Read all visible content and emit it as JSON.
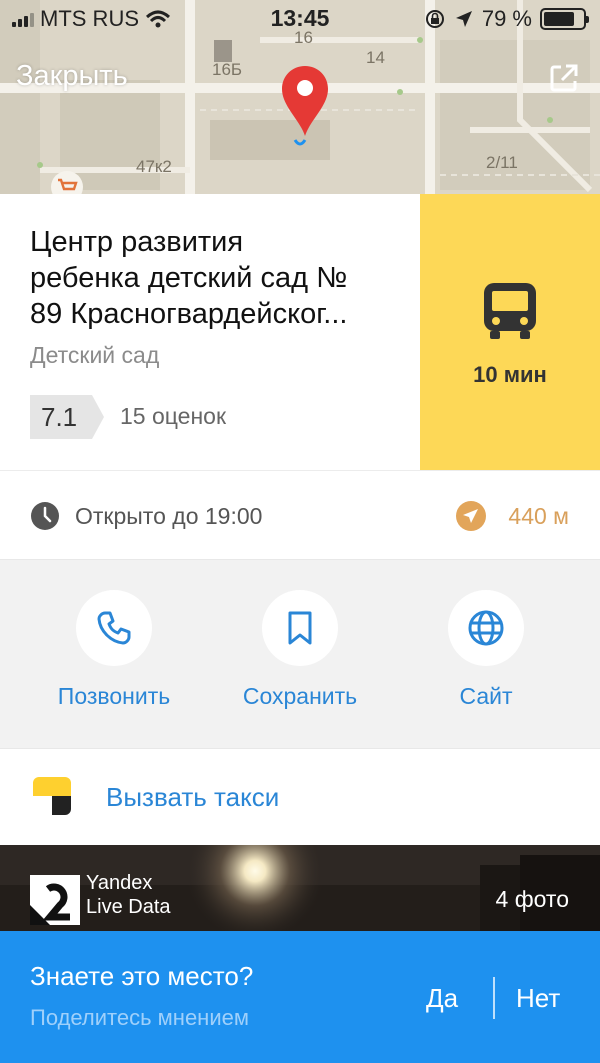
{
  "status_bar": {
    "carrier": "MTS RUS",
    "time": "13:45",
    "battery_text": "79 %",
    "battery_level": 0.79
  },
  "map": {
    "close_label": "Закрыть",
    "labels": [
      "16",
      "16Б",
      "14",
      "47к2",
      "2/11"
    ]
  },
  "place": {
    "title_lines": [
      "Центр развития",
      "ребенка детский сад №",
      "89 Красногвардейског..."
    ],
    "category": "Детский сад",
    "rating": "7.1",
    "rating_count": "15 оценок"
  },
  "route": {
    "icon": "bus-icon",
    "time": "10 мин"
  },
  "hours": {
    "text": "Открыто до 19:00",
    "distance": "440 м"
  },
  "actions": [
    {
      "label": "Позвонить",
      "icon": "phone-icon"
    },
    {
      "label": "Сохранить",
      "icon": "bookmark-icon"
    },
    {
      "label": "Сайт",
      "icon": "globe-icon"
    }
  ],
  "taxi": {
    "label": "Вызвать такси"
  },
  "photos": {
    "provider_line1": "Yandex",
    "provider_line2": "Live Data",
    "count": "4 фото"
  },
  "feedback": {
    "question": "Знаете это место?",
    "subtitle": "Поделитесь мнением",
    "yes": "Да",
    "no": "Нет"
  },
  "colors": {
    "accent_blue": "#2a86d6",
    "route_yellow": "#fdd857",
    "banner_blue": "#1e91ef",
    "pin_red": "#e53935",
    "distance_orange": "#d9a05b"
  }
}
